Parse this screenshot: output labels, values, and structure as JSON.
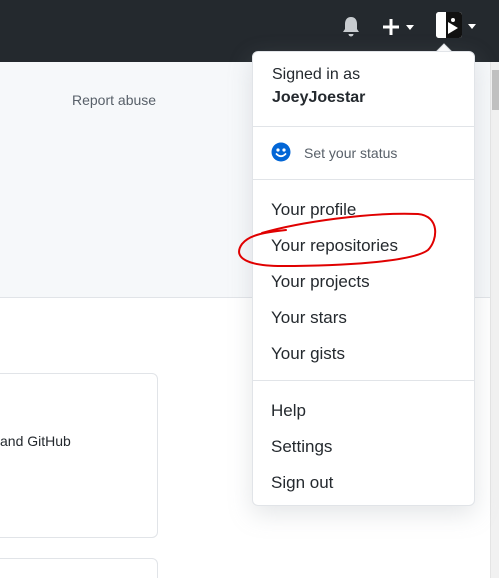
{
  "header": {
    "icons": [
      "bell-icon",
      "plus-icon",
      "chevron-down-icon",
      "avatar"
    ]
  },
  "page": {
    "report_abuse": "Report abuse",
    "card_text": "and GitHub"
  },
  "dropdown": {
    "signed_in_as": "Signed in as",
    "username": "JoeyJoestar",
    "status": "Set your status",
    "items": {
      "profile": "Your profile",
      "repositories": "Your repositories",
      "projects": "Your projects",
      "stars": "Your stars",
      "gists": "Your gists",
      "help": "Help",
      "settings": "Settings",
      "sign_out": "Sign out"
    }
  },
  "colors": {
    "header_bg": "#24292e",
    "annotation_red": "#e00000",
    "status_icon": "#0366d6"
  }
}
